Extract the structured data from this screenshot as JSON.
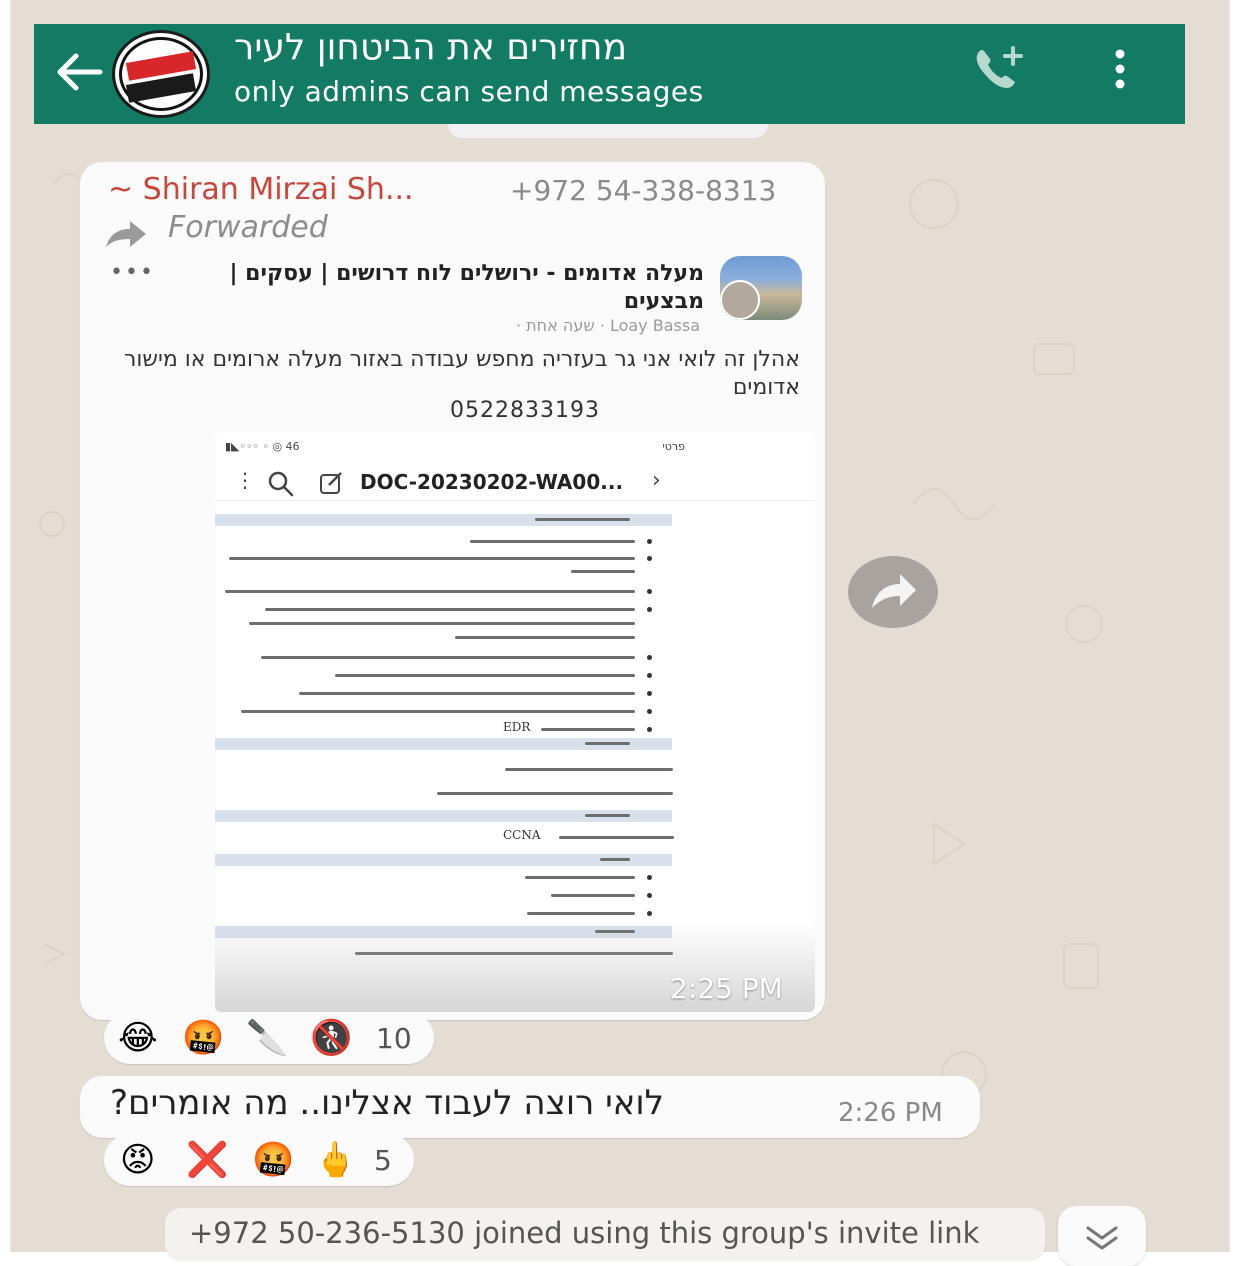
{
  "header": {
    "title": "מחזירים את הביטחון לעיר",
    "subtitle": "only admins can send messages",
    "avatar_icon": "group-logo",
    "back_icon": "arrow-left-icon",
    "call_icon": "add-call-icon",
    "menu_icon": "more-vertical-icon",
    "color": "#137a64"
  },
  "message1": {
    "sender": "~ Shiran Mirzai Sh...",
    "phone": "+972 54-338-8313",
    "forwarded_label": "Forwarded",
    "post": {
      "group_name": "מעלה אדומים - ירושלים לוח דרושים | עסקים | מבצעים",
      "author": "Loay Bassa · שעה אחת ·",
      "text": "אהלן זה לואי אני גר בעזריה מחפש עבודה באזור מעלה ארומים או מישור אדומים",
      "phone": "0522833193",
      "document": {
        "filename": "DOC-20230202-WA00...",
        "status_left": "▮◣◦◦◦ ◦ ◎ 46",
        "status_right": "פרטי"
      }
    },
    "time": "2:25 PM",
    "reactions": {
      "emojis": [
        "😂",
        "🤬",
        "🔪",
        "🚷"
      ],
      "count": "10"
    }
  },
  "message2": {
    "text": "לואי רוצה לעבוד אצלינו.. מה אומרים?",
    "time": "2:26 PM",
    "reactions": {
      "emojis": [
        "😡",
        "❌",
        "🤬",
        "🖕"
      ],
      "count": "5"
    }
  },
  "system": {
    "joined": "+972 50-236-5130 joined using this group's invite link"
  },
  "colors": {
    "background": "#e3ddd4",
    "sender": "#c7463d",
    "bubble": "#fafafa"
  }
}
